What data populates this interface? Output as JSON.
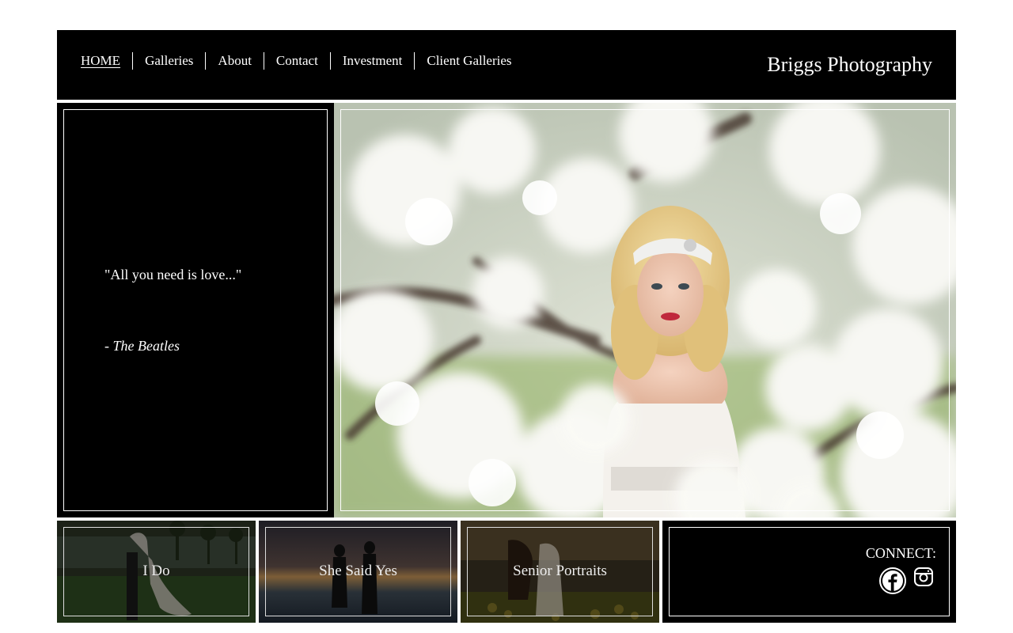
{
  "nav": {
    "items": [
      {
        "label": "HOME"
      },
      {
        "label": "Galleries"
      },
      {
        "label": "About"
      },
      {
        "label": "Contact"
      },
      {
        "label": "Investment"
      },
      {
        "label": "Client Galleries"
      }
    ]
  },
  "brand": {
    "title": "Briggs Photography"
  },
  "quote": {
    "text": "\"All you need is love...\"",
    "author_prefix": "- ",
    "author": "The Beatles"
  },
  "tiles": [
    {
      "label": "I Do"
    },
    {
      "label": "She Said Yes"
    },
    {
      "label": "Senior Portraits"
    }
  ],
  "connect": {
    "label": "CONNECT:",
    "icons": [
      "facebook-icon",
      "instagram-icon"
    ]
  },
  "colors": {
    "background": "#ffffff",
    "panel": "#000000",
    "text": "#ffffff"
  }
}
